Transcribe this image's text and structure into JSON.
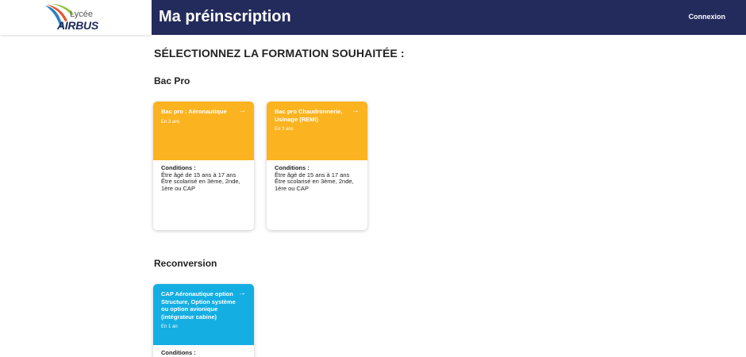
{
  "header": {
    "logo": {
      "lycee": "Lycée",
      "airbus": "AIRBUS"
    },
    "title": "Ma préinscription",
    "login_label": "Connexion"
  },
  "main": {
    "heading": "SÉLECTIONNEZ LA FORMATION SOUHAITÉE :",
    "sections": [
      {
        "title": "Bac Pro",
        "cards": [
          {
            "name": "Bac pro : Aéronautique",
            "duration": "En 3 ans",
            "arrow": "→",
            "conditions_label": "Conditions :",
            "conditions": [
              "Être âgé de 15 ans à 17 ans",
              "Être scolarisé en 3ème, 2nde, 1ère ou CAP"
            ]
          },
          {
            "name": "Bac pro Chaudronnerie, Usinage (REMI)",
            "duration": "En 3 ans",
            "arrow": "→",
            "conditions_label": "Conditions :",
            "conditions": [
              "Être âgé de 15 ans à 17 ans",
              "Être scolarisé en 3ème, 2nde, 1ère ou CAP"
            ]
          }
        ]
      },
      {
        "title": "Reconversion",
        "cards": [
          {
            "name": "CAP Aéronautique option Structure, Option système ou option avionique (intégrateur cabine)",
            "duration": "En 1 an",
            "arrow": "→",
            "conditions_label": "Conditions :"
          }
        ]
      }
    ]
  },
  "colors": {
    "navbar": "#232b5c",
    "bac_pro_card": "#fbb31f",
    "reconversion_card": "#14aee3"
  }
}
